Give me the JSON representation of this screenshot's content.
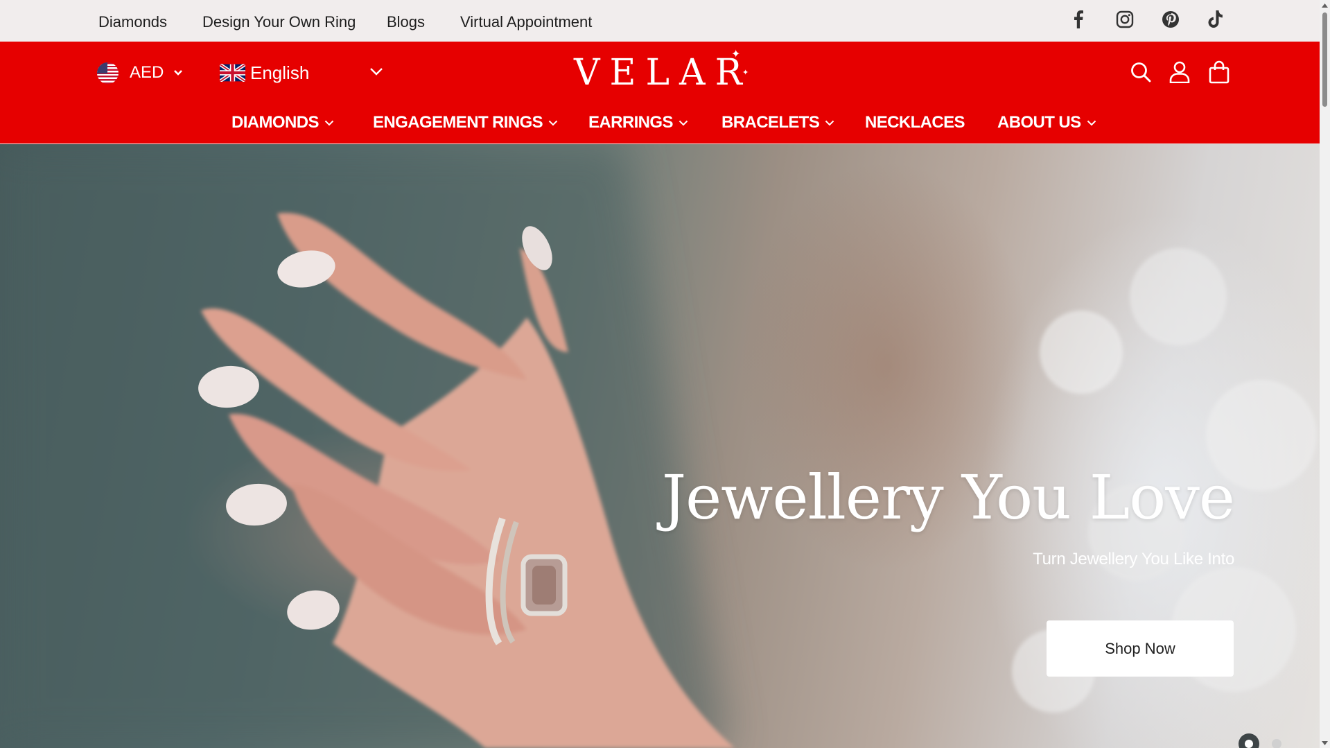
{
  "topbar": {
    "links": [
      "Diamonds",
      "Design Your Own Ring",
      "Blogs",
      "Virtual Appointment"
    ],
    "social_icons": [
      "facebook-icon",
      "instagram-icon",
      "pinterest-icon",
      "tiktok-icon"
    ]
  },
  "header": {
    "currency": "AED",
    "language": "English",
    "logo_text": "VELAR",
    "icons": [
      "search-icon",
      "account-icon",
      "cart-icon"
    ],
    "nav": [
      {
        "label": "DIAMONDS",
        "dropdown": true
      },
      {
        "label": "ENGAGEMENT RINGS",
        "dropdown": true
      },
      {
        "label": "EARRINGS",
        "dropdown": true
      },
      {
        "label": "BRACELETS",
        "dropdown": true
      },
      {
        "label": "NECKLACES",
        "dropdown": false
      },
      {
        "label": "ABOUT US",
        "dropdown": true
      }
    ]
  },
  "hero": {
    "title": "Jewellery You Love",
    "subtitle": "Turn Jewellery You Like Into",
    "cta": "Shop Now",
    "slide_count": 2,
    "active_slide": 1
  },
  "colors": {
    "brand_red": "#e60000",
    "topbar_bg": "#f1eded",
    "text_dark": "#1d1d1d"
  }
}
